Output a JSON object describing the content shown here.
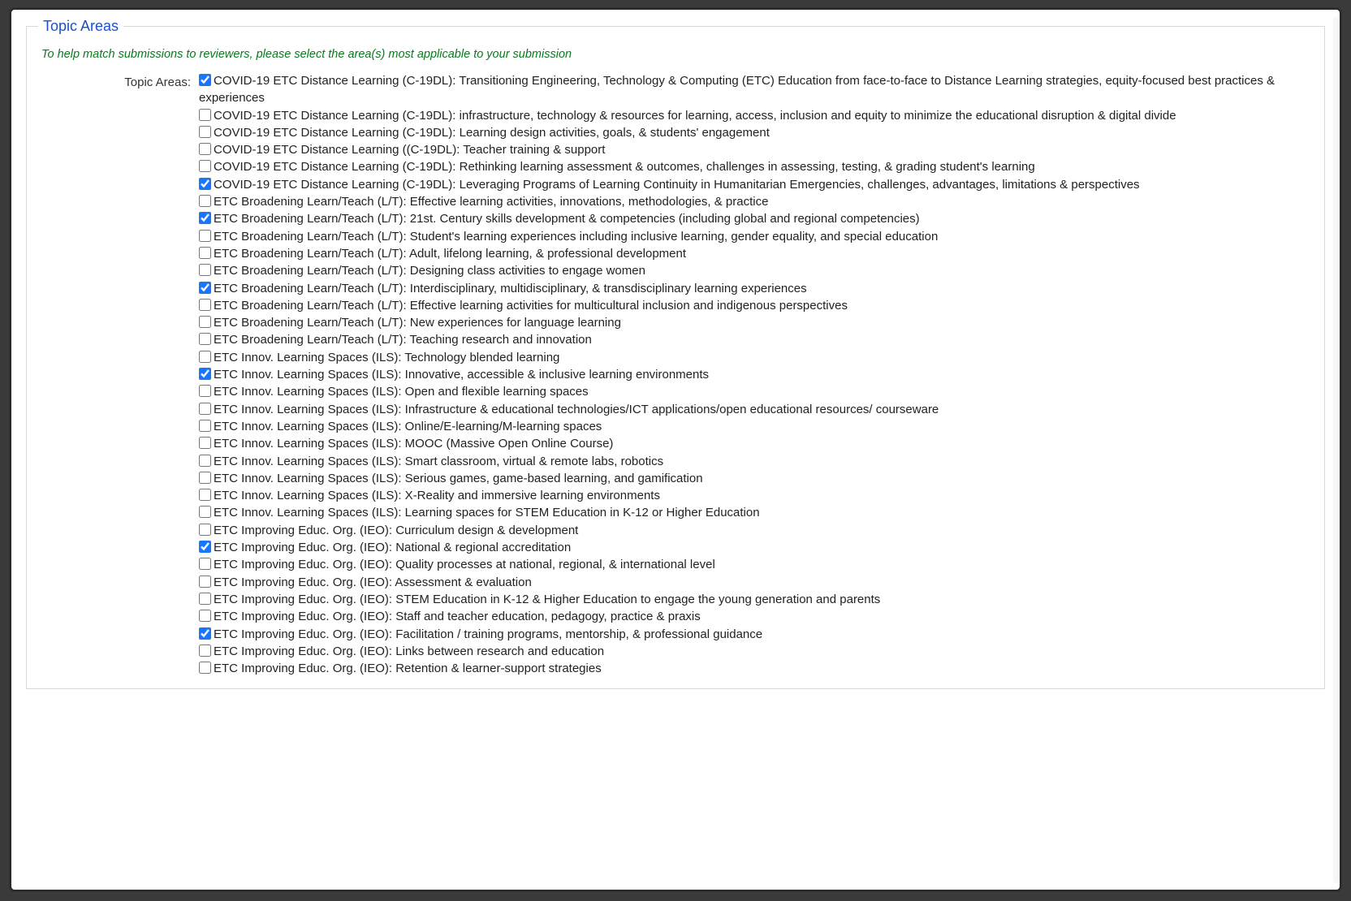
{
  "fieldset": {
    "legend": "Topic Areas",
    "help_text": "To help match submissions to reviewers, please select the area(s) most applicable to your submission",
    "label": "Topic Areas:"
  },
  "topics": [
    {
      "checked": true,
      "label": "COVID-19 ETC Distance Learning (C-19DL): Transitioning Engineering, Technology & Computing (ETC) Education from face-to-face to Distance Learning strategies, equity-focused best practices & experiences"
    },
    {
      "checked": false,
      "label": "COVID-19 ETC Distance Learning (C-19DL): infrastructure, technology & resources for learning, access, inclusion and equity to minimize the educational disruption & digital divide"
    },
    {
      "checked": false,
      "label": "COVID-19 ETC Distance Learning (C-19DL): Learning design activities, goals, & students' engagement"
    },
    {
      "checked": false,
      "label": "COVID-19 ETC Distance Learning ((C-19DL): Teacher training & support"
    },
    {
      "checked": false,
      "label": "COVID-19 ETC Distance Learning (C-19DL): Rethinking learning assessment & outcomes, challenges in assessing, testing, & grading student's learning"
    },
    {
      "checked": true,
      "label": "COVID-19 ETC Distance Learning (C-19DL): Leveraging Programs of Learning Continuity in Humanitarian Emergencies, challenges, advantages, limitations & perspectives"
    },
    {
      "checked": false,
      "label": "ETC Broadening Learn/Teach (L/T): Effective learning activities, innovations, methodologies, & practice"
    },
    {
      "checked": true,
      "label": "ETC Broadening Learn/Teach (L/T): 21st. Century skills development & competencies (including global and regional competencies)"
    },
    {
      "checked": false,
      "label": "ETC Broadening Learn/Teach (L/T): Student's learning experiences including inclusive learning, gender equality, and special education"
    },
    {
      "checked": false,
      "label": "ETC Broadening Learn/Teach (L/T): Adult, lifelong learning, & professional development"
    },
    {
      "checked": false,
      "label": "ETC Broadening Learn/Teach (L/T): Designing class activities to engage women"
    },
    {
      "checked": true,
      "label": "ETC Broadening Learn/Teach (L/T): Interdisciplinary, multidisciplinary, & transdisciplinary learning experiences"
    },
    {
      "checked": false,
      "label": "ETC Broadening Learn/Teach (L/T): Effective learning activities for multicultural inclusion and indigenous perspectives"
    },
    {
      "checked": false,
      "label": "ETC Broadening Learn/Teach (L/T): New experiences for language learning"
    },
    {
      "checked": false,
      "label": "ETC Broadening Learn/Teach (L/T): Teaching research and innovation"
    },
    {
      "checked": false,
      "label": "ETC Innov. Learning Spaces (ILS): Technology blended learning"
    },
    {
      "checked": true,
      "label": "ETC Innov. Learning Spaces (ILS): Innovative, accessible & inclusive learning environments"
    },
    {
      "checked": false,
      "label": "ETC Innov. Learning Spaces (ILS): Open and flexible learning spaces"
    },
    {
      "checked": false,
      "label": "ETC Innov. Learning Spaces (ILS): Infrastructure & educational technologies/ICT applications/open educational resources/ courseware"
    },
    {
      "checked": false,
      "label": "ETC Innov. Learning Spaces (ILS): Online/E-learning/M-learning spaces"
    },
    {
      "checked": false,
      "label": "ETC Innov. Learning Spaces (ILS): MOOC (Massive Open Online Course)"
    },
    {
      "checked": false,
      "label": "ETC Innov. Learning Spaces (ILS): Smart classroom, virtual & remote labs, robotics"
    },
    {
      "checked": false,
      "label": "ETC Innov. Learning Spaces (ILS): Serious games, game-based learning, and gamification"
    },
    {
      "checked": false,
      "label": "ETC Innov. Learning Spaces (ILS): X-Reality and immersive learning environments"
    },
    {
      "checked": false,
      "label": "ETC Innov. Learning Spaces (ILS): Learning spaces for STEM Education in K-12 or Higher Education"
    },
    {
      "checked": false,
      "label": "ETC Improving Educ. Org. (IEO): Curriculum design & development"
    },
    {
      "checked": true,
      "label": "ETC Improving Educ. Org. (IEO): National & regional accreditation"
    },
    {
      "checked": false,
      "label": "ETC Improving Educ. Org. (IEO): Quality processes at national, regional, & international level"
    },
    {
      "checked": false,
      "label": "ETC Improving Educ. Org. (IEO): Assessment & evaluation"
    },
    {
      "checked": false,
      "label": "ETC Improving Educ. Org. (IEO): STEM Education in K-12 & Higher Education to engage the young generation and parents"
    },
    {
      "checked": false,
      "label": "ETC Improving Educ. Org. (IEO): Staff and teacher education, pedagogy, practice & praxis"
    },
    {
      "checked": true,
      "label": "ETC Improving Educ. Org. (IEO): Facilitation / training programs, mentorship, & professional guidance"
    },
    {
      "checked": false,
      "label": "ETC Improving Educ. Org. (IEO): Links between research and education"
    },
    {
      "checked": false,
      "label": "ETC Improving Educ. Org. (IEO): Retention & learner-support strategies"
    }
  ]
}
